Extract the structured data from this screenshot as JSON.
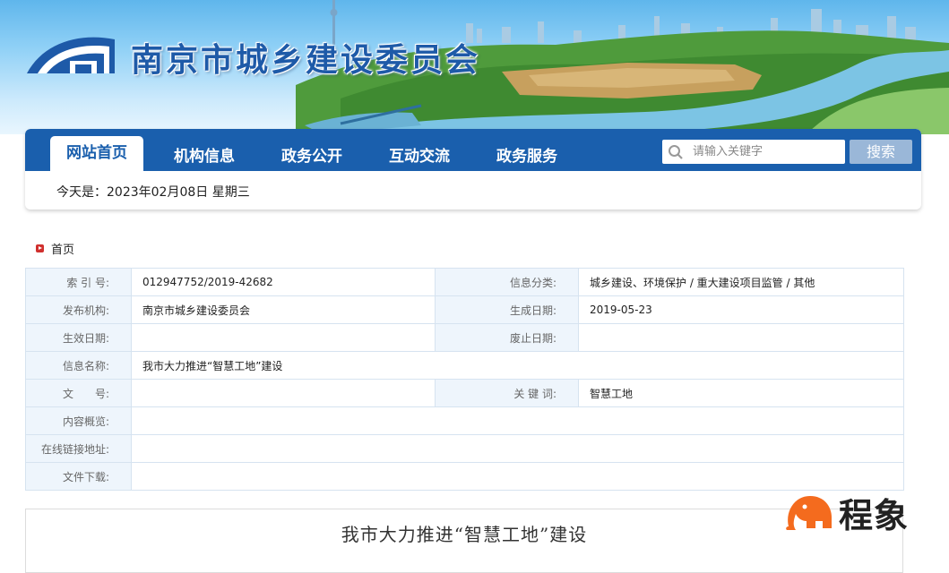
{
  "site": {
    "title": "南京市城乡建设委员会"
  },
  "nav": {
    "items": [
      "网站首页",
      "机构信息",
      "政务公开",
      "互动交流",
      "政务服务"
    ],
    "search_placeholder": "请输入关键字",
    "search_button": "搜索",
    "date_label": "今天是：",
    "date_value": "2023年02月08日",
    "weekday": "星期三"
  },
  "breadcrumb": {
    "home": "首页"
  },
  "meta": {
    "index_label": "索 引 号:",
    "index_value": "012947752/2019-42682",
    "category_label": "信息分类:",
    "category_value": "城乡建设、环境保护 / 重大建设项目监管 / 其他",
    "publisher_label": "发布机构:",
    "publisher_value": "南京市城乡建设委员会",
    "created_label": "生成日期:",
    "created_value": "2019-05-23",
    "effective_label": "生效日期:",
    "effective_value": "",
    "expiry_label": "废止日期:",
    "expiry_value": "",
    "name_label": "信息名称:",
    "name_value": "我市大力推进“智慧工地”建设",
    "doc_label": "文　　号:",
    "doc_value": "",
    "keyword_label": "关 键 词:",
    "keyword_value": "智慧工地",
    "summary_label": "内容概览:",
    "summary_value": "",
    "link_label": "在线链接地址:",
    "link_value": "",
    "download_label": "文件下载:",
    "download_value": ""
  },
  "article": {
    "title": "我市大力推进“智慧工地”建设"
  },
  "watermark": {
    "text": "程象"
  },
  "colors": {
    "nav_blue": "#1a5fad",
    "label_bg": "#eef5fc",
    "accent_red": "#d0302e",
    "watermark_orange": "#f46b1e"
  }
}
